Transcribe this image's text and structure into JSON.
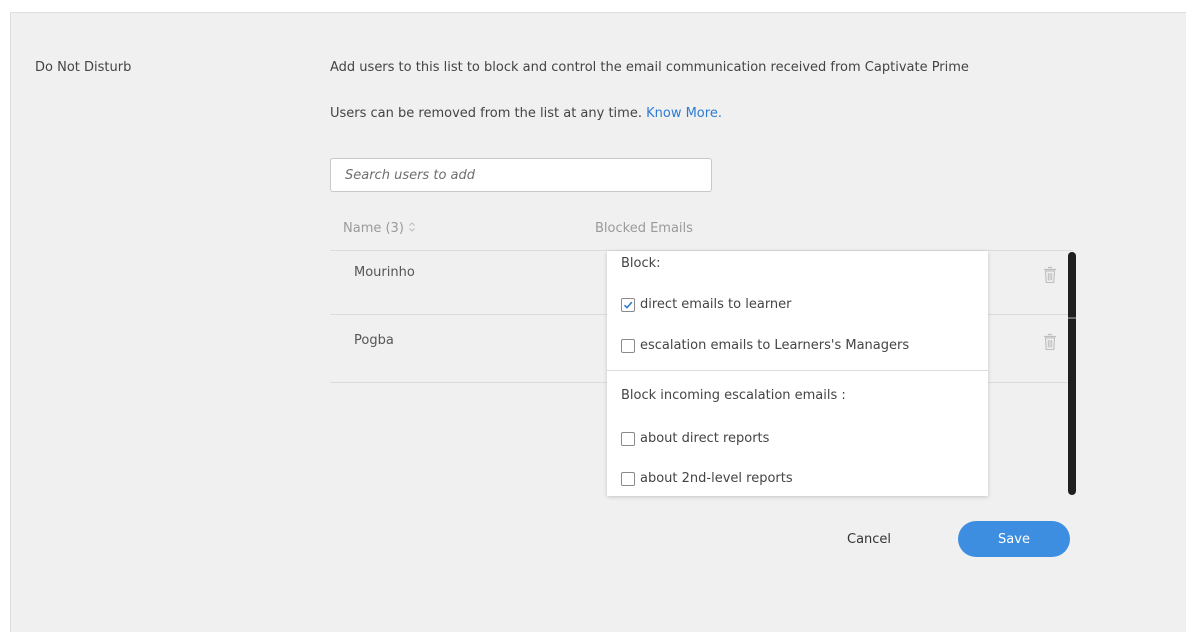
{
  "section": {
    "label": "Do Not Disturb",
    "description": "Add users to this list to block and control the email communication received from Captivate Prime",
    "note_prefix": "Users can be removed from the list at any time. ",
    "know_more": "Know More."
  },
  "search": {
    "placeholder": "Search users to add"
  },
  "table": {
    "columns": {
      "name": "Name (3)",
      "blocked": "Blocked Emails"
    },
    "rows": [
      {
        "name": "Mourinho"
      },
      {
        "name": "Pogba"
      }
    ]
  },
  "dropdown": {
    "block_heading": "Block:",
    "block_options": [
      {
        "label": "direct emails to learner",
        "checked": true
      },
      {
        "label": "escalation emails to Learners's Managers",
        "checked": false
      }
    ],
    "escalation_heading": "Block incoming escalation emails :",
    "escalation_options": [
      {
        "label": "about direct reports",
        "checked": false
      },
      {
        "label": "about 2nd-level reports",
        "checked": false
      }
    ]
  },
  "actions": {
    "cancel": "Cancel",
    "save": "Save"
  },
  "colors": {
    "link": "#2d7bd2",
    "save_button": "#3d8ee0",
    "panel_bg": "#f0f0f0"
  }
}
